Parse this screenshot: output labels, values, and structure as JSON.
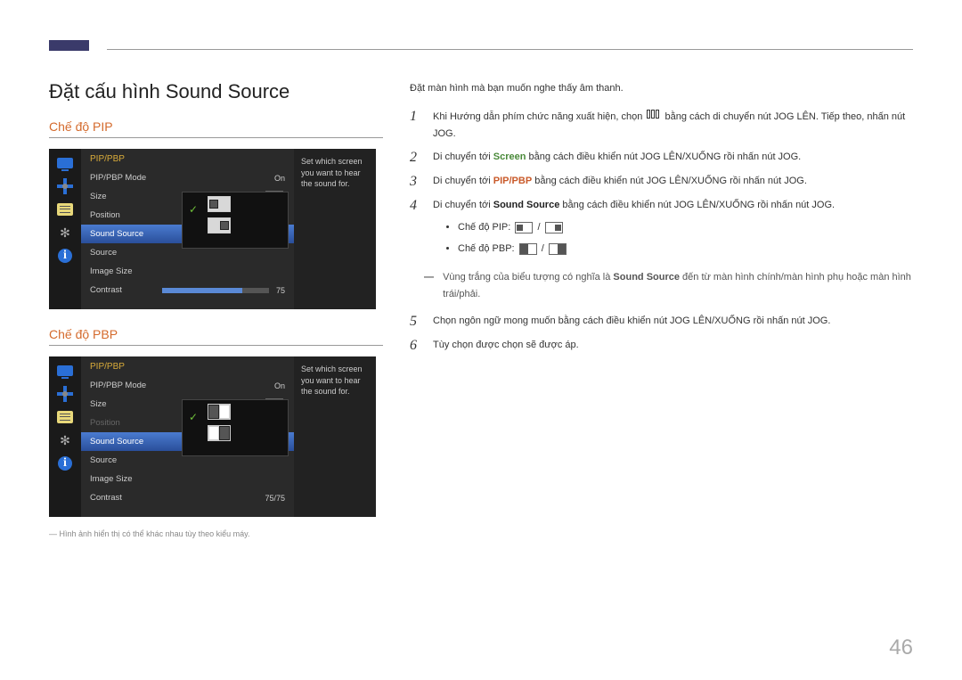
{
  "page_number": "46",
  "heading": "Đặt cấu hình Sound Source",
  "modes": {
    "pip_label": "Chế độ PIP",
    "pbp_label": "Chế độ PBP"
  },
  "osd": {
    "title": "PIP/PBP",
    "items": {
      "mode": "PIP/PBP Mode",
      "mode_value": "On",
      "size": "Size",
      "position": "Position",
      "sound_source": "Sound Source",
      "source": "Source",
      "image_size": "Image Size",
      "contrast": "Contrast",
      "contrast_value_pip": "75",
      "contrast_value_pbp": "75/75"
    },
    "hint": "Set which screen you want to hear the sound for."
  },
  "caption": "Hình ảnh hiển thị có thể khác nhau tùy theo kiểu máy.",
  "intro": "Đặt màn hình mà bạn muốn nghe thấy âm thanh.",
  "steps": {
    "s1_a": "Khi Hướng dẫn phím chức năng xuất hiện, chọn ",
    "s1_b": " bằng cách di chuyển nút JOG LÊN. Tiếp theo, nhấn nút JOG.",
    "s2_a": "Di chuyển tới ",
    "s2_hl": "Screen",
    "s2_b": " bằng cách điều khiển nút JOG LÊN/XUỐNG rồi nhấn nút JOG.",
    "s3_a": "Di chuyển tới ",
    "s3_hl": "PIP/PBP",
    "s3_b": " bằng cách điều khiển nút JOG LÊN/XUỐNG rồi nhấn nút JOG.",
    "s4_a": "Di chuyển tới ",
    "s4_hl": "Sound Source",
    "s4_b": " bằng cách điều khiển nút JOG LÊN/XUỐNG rồi nhấn nút JOG.",
    "b1": "Chế độ PIP:",
    "b2": "Chế độ PBP:",
    "note_a": "Vùng trắng của biểu tượng có nghĩa là ",
    "note_hl": "Sound Source",
    "note_b": " đến từ màn hình chính/màn hình phụ hoặc màn hình trái/phải.",
    "s5": "Chọn ngôn ngữ mong muốn bằng cách điều khiển nút JOG LÊN/XUỐNG rồi nhấn nút JOG.",
    "s6": "Tùy chọn được chọn sẽ được áp."
  }
}
